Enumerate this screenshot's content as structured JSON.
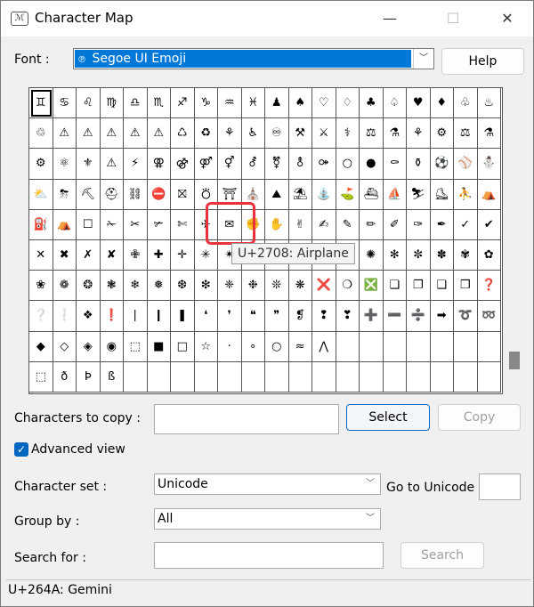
{
  "window": {
    "title": "Character Map",
    "minimize": "—",
    "maximize": "☐",
    "close": "✕",
    "app_icon": "ℳ"
  },
  "font": {
    "label": "Font :",
    "value": "Segoe UI Emoji",
    "font_icon": "℗"
  },
  "help_label": "Help",
  "grid": {
    "rows": [
      [
        "♊",
        "♋",
        "♌",
        "♍",
        "♎",
        "♏",
        "♐",
        "♑",
        "♒",
        "♓",
        "♟",
        "♠",
        "♡",
        "♢",
        "♣",
        "♤",
        "♥",
        "♦",
        "♧",
        "♨"
      ],
      [
        "♲",
        "♳",
        "♴",
        "♵",
        "♶",
        "♷",
        "♸",
        "♹",
        "♺",
        "♻",
        "♼",
        "♽",
        "♾",
        "♿",
        "⚒",
        "⚔",
        "⚕",
        "⚖",
        "⚗",
        "⚘"
      ],
      [
        "⚙",
        "⚛",
        "⚜",
        "⚠",
        "⚡",
        "⚢",
        "⚣",
        "⚤",
        "⚥",
        "⚦",
        "⚧",
        "⚨",
        "⚩",
        "⚪",
        "⚫",
        "⚰",
        "⚱",
        "⚽",
        "⚾",
        "⛄"
      ],
      [
        "⛅",
        "⛈",
        "⛏",
        "⛑",
        "⛓",
        "⛔",
        "⛝",
        "⛣",
        "⛩",
        "⛪",
        "⛰",
        "⛱",
        "⛲",
        "⛳",
        "⛴",
        "⛵",
        "⛷",
        "⛸",
        "⛹",
        "⛺"
      ],
      [
        "⛽",
        "✂",
        "✅",
        "✁",
        "✂",
        "✃",
        "✄",
        "✆",
        "✈",
        "✉",
        "✊",
        "✋",
        "✌",
        "✍",
        "✎",
        "✏",
        "✐",
        "✑",
        "✓",
        "✔"
      ],
      [
        "✕",
        "✖",
        "✗",
        "✘",
        "✙",
        "✚",
        "✛",
        "✳",
        "✴",
        "✵",
        "✶",
        "✷",
        "✸",
        "✹",
        "✺",
        "✻",
        "✼",
        "✽",
        "✾",
        "✿"
      ],
      [
        "❀",
        "❁",
        "❂",
        "❃",
        "❄",
        "❅",
        "❆",
        "❇",
        "❈",
        "❉",
        "❊",
        "❋",
        "❌",
        "❍",
        "❎",
        "❏",
        "❐",
        "❑",
        "❒",
        "❓"
      ],
      [
        "❔",
        "❕",
        "❖",
        "❗",
        "❘",
        "❙",
        "❚",
        "❛",
        "❜",
        "❝",
        "❞",
        "❡",
        "❢",
        "❣",
        "➕",
        "➖",
        "➗",
        "➡",
        "➰",
        "➿"
      ],
      [
        "⤴",
        "⤵",
        "⬅",
        "⬆",
        "⬇",
        "⬛",
        "⬜",
        "⭐",
        "⭕",
        "〰",
        "〽",
        "㊗",
        "㊙",
        "",
        "",
        "",
        "",
        "",
        "",
        ""
      ],
      [
        "",
        "",
        "",
        "",
        "",
        "",
        "",
        "",
        "",
        "",
        "",
        "",
        "",
        "",
        "",
        "",
        "",
        "",
        "",
        ""
      ]
    ],
    "selected_row": 0,
    "selected_col": 0
  },
  "display_rows": [
    [
      "♊",
      "♋",
      "♌",
      "♍",
      "♎",
      "♏",
      "♐",
      "♑",
      "♒",
      "♓",
      "♟",
      "♠",
      "♡",
      "♢",
      "♣",
      "♤",
      "♥",
      "♦",
      "♧",
      "♨"
    ],
    [
      "♲",
      "⚠",
      "⚠",
      "⚠",
      "⚠",
      "⚠",
      "♺",
      "♻",
      "⚘",
      "♿",
      "♾",
      "⚒",
      "⚔",
      "⚕",
      "⚖",
      "⚗",
      "⚘",
      "⚙",
      "⚖",
      "⚗"
    ],
    [
      "⚙",
      "⚛",
      "⚜",
      "⚠",
      "⚡",
      "⚢",
      "⚣",
      "⚤",
      "⚥",
      "⚦",
      "⚧",
      "⚨",
      "⚩",
      "○",
      "●",
      "⚰",
      "⚱",
      "⚽",
      "⚾",
      "⛄"
    ],
    [
      "⛅",
      "⛈",
      "⛏",
      "⛑",
      "⛓",
      "⛔",
      "⛝",
      "⛣",
      "⛩",
      "⛪",
      "⛰",
      "⛱",
      "⛲",
      "⛳",
      "⛴",
      "⛵",
      "⛷",
      "⛸",
      "⛹",
      "⛺"
    ],
    [
      "⛽",
      "⛺",
      "☐",
      "✁",
      "✂",
      "✃",
      "✄",
      "✈",
      "✉",
      "✊",
      "✋",
      "✌",
      "✍",
      "✎",
      "✏",
      "✐",
      "✑",
      "✒",
      "✓",
      "✔"
    ],
    [
      "✕",
      "✖",
      "✗",
      "✘",
      "✙",
      "✚",
      "✛",
      "✳",
      "✴",
      "✵",
      "✶",
      "✷",
      "✸",
      "✹",
      "✺",
      "✻",
      "✼",
      "✽",
      "✾",
      "✿"
    ],
    [
      "❀",
      "❁",
      "❂",
      "❃",
      "❄",
      "❅",
      "❆",
      "❇",
      "❈",
      "❉",
      "❊",
      "❋",
      "❌",
      "❍",
      "❎",
      "❏",
      "❐",
      "❑",
      "❒",
      "❓"
    ],
    [
      "❔",
      "❕",
      "❖",
      "❗",
      "❘",
      "❙",
      "❚",
      "❛",
      "❜",
      "❝",
      "❞",
      "❡",
      "❢",
      "❣",
      "➕",
      "➖",
      "➗",
      "➡",
      "➰",
      "➿"
    ],
    [
      "◆",
      "◇",
      "◈",
      "◉",
      "⬚",
      "■",
      "□",
      "☆",
      "·",
      "∘",
      "○",
      "≈",
      "⋀",
      "",
      "",
      "",
      "",
      "",
      "",
      ""
    ],
    [
      "⬚",
      "ð",
      "Þ",
      "ß",
      "",
      "",
      "",
      "",
      "",
      "",
      "",
      "",
      "",
      "",
      "",
      "",
      "",
      "",
      "",
      ""
    ]
  ],
  "tooltip": "U+2708: Airplane",
  "copy": {
    "label": "Characters to copy :",
    "value": "",
    "select_label": "Select",
    "copy_label": "Copy"
  },
  "advanced": {
    "label": "Advanced view",
    "checked": true,
    "check_glyph": "✓"
  },
  "charset": {
    "label": "Character set :",
    "value": "Unicode",
    "goto_label": "Go to Unicode",
    "goto_value": ""
  },
  "groupby": {
    "label": "Group by :",
    "value": "All"
  },
  "search": {
    "label": "Search for :",
    "value": "",
    "button_label": "Search"
  },
  "status": "U+264A: Gemini",
  "dropdown_arrow": "﹀"
}
